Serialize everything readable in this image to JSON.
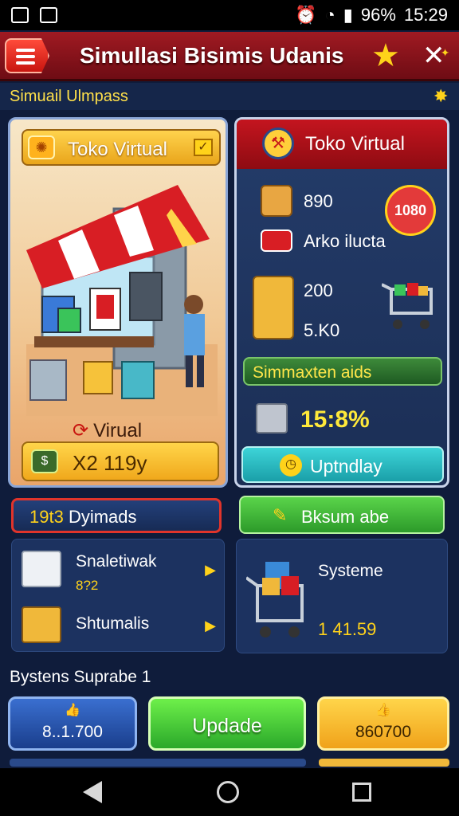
{
  "status": {
    "battery": "96%",
    "time": "15:29"
  },
  "header": {
    "title": "Simullasi Bisimis Udanis"
  },
  "subheader": {
    "title": "Simuail Ulmpass"
  },
  "left_card": {
    "tag_label": "Toko Virtual",
    "virtual_label": "Virual",
    "action_label": "X2 119y"
  },
  "right_card": {
    "head_label": "Toko Virtual",
    "row1_value": "890",
    "row2_label": "Arko ilucta",
    "heart_value": "1080",
    "row3_value": "200",
    "row4_value": "5.K0",
    "sim_label": "Simmaxten aids",
    "percent": "15:8%",
    "update_label": "Uptndlay"
  },
  "dynamics": {
    "head_prefix": "19t3",
    "head_label": "Dyimads",
    "items": [
      {
        "label": "Snaletiwak",
        "value": "8?2"
      },
      {
        "label": "Shtumalis"
      }
    ]
  },
  "right_panel": {
    "head_label": "Bksum abe",
    "title": "Systeme",
    "value": "1 41.59"
  },
  "section": {
    "title": "Bystens Suprabe 1"
  },
  "buttons": [
    {
      "label": "8..1.700"
    },
    {
      "label": "Updade"
    },
    {
      "label": "860700"
    }
  ],
  "colors": {
    "accent_red": "#c4151f",
    "accent_yellow": "#ffd21a",
    "background": "#0f1c3b"
  }
}
